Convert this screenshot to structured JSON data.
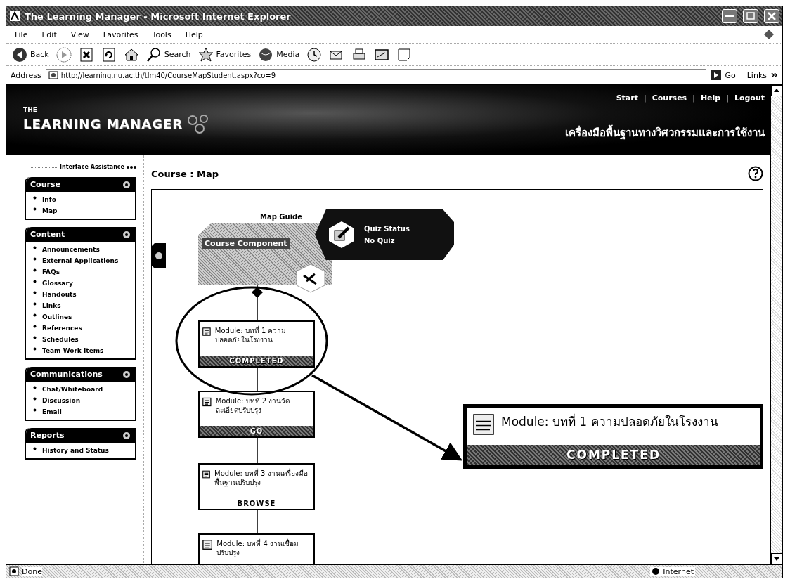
{
  "window": {
    "title": "The Learning Manager - Microsoft Internet Explorer"
  },
  "menu_bar": [
    "File",
    "Edit",
    "View",
    "Favorites",
    "Tools",
    "Help"
  ],
  "toolbar": [
    {
      "kind": "back",
      "label": "Back"
    },
    {
      "kind": "forward"
    },
    {
      "kind": "stop"
    },
    {
      "kind": "refresh"
    },
    {
      "kind": "home"
    },
    {
      "kind": "search",
      "label": "Search"
    },
    {
      "kind": "favorites",
      "label": "Favorites"
    },
    {
      "kind": "media",
      "label": "Media"
    },
    {
      "kind": "history"
    },
    {
      "kind": "mail"
    },
    {
      "kind": "print"
    },
    {
      "kind": "edit"
    },
    {
      "kind": "discuss"
    }
  ],
  "address_bar": {
    "label": "Address",
    "url": "http://learning.nu.ac.th/tlm40/CourseMapStudent.aspx?co=9",
    "go": "Go",
    "links": "Links"
  },
  "header": {
    "logo_small": "THE",
    "logo": "LEARNING MANAGER",
    "nav": [
      {
        "kind": "link",
        "text": "Start"
      },
      {
        "kind": "separator",
        "text": "|"
      },
      {
        "kind": "link",
        "text": "Courses"
      },
      {
        "kind": "separator",
        "text": "|"
      },
      {
        "kind": "link",
        "text": "Help"
      },
      {
        "kind": "separator",
        "text": "|"
      },
      {
        "kind": "link",
        "text": "Logout"
      }
    ],
    "subtitle": "เครื่องมือพื้นฐานทางวิศวกรรมและการใช้งาน"
  },
  "sidebar": {
    "assistance": "Interface Assistance",
    "panels": [
      {
        "title": "Course",
        "items": [
          "Info",
          "Map"
        ]
      },
      {
        "title": "Content",
        "items": [
          "Announcements",
          "External Applications",
          "FAQs",
          "Glossary",
          "Handouts",
          "Links",
          "Outlines",
          "References",
          "Schedules",
          "Team Work Items"
        ]
      },
      {
        "title": "Communications",
        "items": [
          "Chat/Whiteboard",
          "Discussion",
          "Email"
        ]
      },
      {
        "title": "Reports",
        "items": [
          "History and Status"
        ]
      }
    ]
  },
  "page_title": "Course : Map",
  "map": {
    "guide_label": "Map Guide",
    "component_title": "Course Component",
    "quiz": {
      "title": "Quiz Status",
      "value": "No Quiz"
    },
    "modules": [
      {
        "title": "Module: บทที่ 1 ความปลอดภัยในโรงงาน",
        "status": "COMPLETED",
        "kind": "banner"
      },
      {
        "title": "Module: บทที่ 2 งานวัดละเอียดปรับปรุง",
        "status": "GO",
        "kind": "banner"
      },
      {
        "title": "Module: บทที่ 3 งานเครื่องมือพื้นฐานปรับปรุง",
        "status": "BROWSE",
        "kind": "plain"
      },
      {
        "title": "Module: บทที่ 4 งานเชื่อมปรับปรุง"
      }
    ],
    "callout": {
      "title": "Module: บทที่ 1 ความปลอดภัยในโรงงาน",
      "status": "COMPLETED",
      "kind": "banner"
    }
  },
  "status_bar": {
    "text": "Done",
    "zone": "Internet"
  }
}
